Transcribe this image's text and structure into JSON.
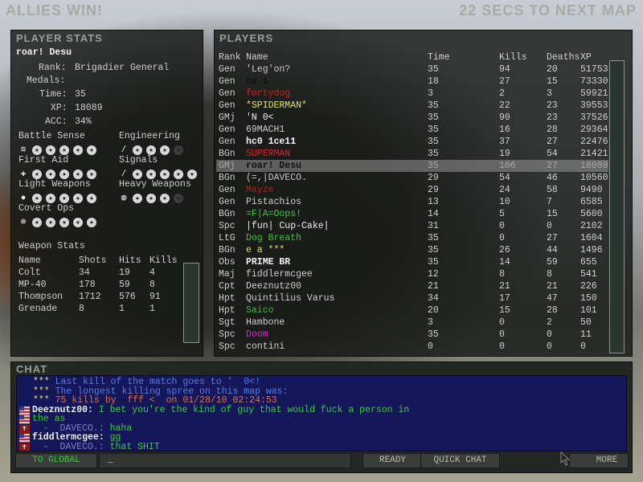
{
  "header": {
    "result": "ALLIES WIN!",
    "countdown": "22 SECS TO NEXT MAP"
  },
  "player_stats": {
    "title": "PLAYER STATS",
    "player_name": "roar! Desu",
    "rank_label": "Rank:",
    "rank": "Brigadier General",
    "medals_label": "Medals:",
    "time_label": "Time:",
    "time": "35",
    "xp_label": "XP:",
    "xp": "18089",
    "acc_label": "ACC:",
    "acc": "34%",
    "skills": [
      {
        "name": "Battle Sense",
        "icon": "radio-signal-icon",
        "level": 5,
        "max": 5
      },
      {
        "name": "Engineering",
        "icon": "wrench-icon",
        "level": 3,
        "max": 4
      },
      {
        "name": "First Aid",
        "icon": "medic-cross-icon",
        "level": 5,
        "max": 5
      },
      {
        "name": "Signals",
        "icon": "flare-icon",
        "level": 5,
        "max": 5
      },
      {
        "name": "Light Weapons",
        "icon": "pistol-icon",
        "level": 5,
        "max": 5
      },
      {
        "name": "Heavy Weapons",
        "icon": "heavy-weapon-icon",
        "level": 3,
        "max": 4
      },
      {
        "name": "Covert Ops",
        "icon": "crosshair-icon",
        "level": 5,
        "max": 5
      }
    ],
    "weapon_stats": {
      "title": "Weapon Stats",
      "columns": [
        "Name",
        "Shots",
        "Hits",
        "Kills"
      ],
      "rows": [
        [
          "Colt",
          "34",
          "19",
          "4"
        ],
        [
          "MP-40",
          "178",
          "59",
          "8"
        ],
        [
          "Thompson",
          "1712",
          "576",
          "91"
        ],
        [
          "Grenade",
          "8",
          "1",
          "1"
        ]
      ]
    }
  },
  "players": {
    "title": "PLAYERS",
    "columns": [
      "Rank",
      "Name",
      "Time",
      "Kills",
      "Deaths",
      "XP"
    ],
    "rows": [
      {
        "rank": "Gen",
        "name": "'Leg'on?",
        "color": "#c8c8c8",
        "time": "35",
        "kills": "94",
        "deaths": "20",
        "xp": "51753"
      },
      {
        "rank": "Gen",
        "name": "ca 1",
        "color": "#111111",
        "time": "18",
        "kills": "27",
        "deaths": "15",
        "xp": "73330"
      },
      {
        "rank": "Gen",
        "name": "fortydog",
        "color": "#d02020",
        "time": "3",
        "kills": "2",
        "deaths": "3",
        "xp": "59921"
      },
      {
        "rank": "Gen",
        "name": "*SPIDERMAN*",
        "color": "#e6e060",
        "time": "35",
        "kills": "22",
        "deaths": "23",
        "xp": "39553"
      },
      {
        "rank": "GMj",
        "name": "'N 0<",
        "color": "#f0f0f0",
        "time": "35",
        "kills": "90",
        "deaths": "23",
        "xp": "37526"
      },
      {
        "rank": "Gen",
        "name": "69MACH1",
        "color": "#cfcfcf",
        "time": "35",
        "kills": "16",
        "deaths": "28",
        "xp": "29364"
      },
      {
        "rank": "Gen",
        "name": "hc0 1ce11",
        "color": "#f4f4f4",
        "time": "35",
        "kills": "37",
        "deaths": "27",
        "xp": "22476"
      },
      {
        "rank": "BGn",
        "name": "SUPERMAN",
        "color": "#e02020",
        "time": "35",
        "kills": "19",
        "deaths": "54",
        "xp": "21421"
      },
      {
        "rank": "GMj",
        "name": "roar! Desu",
        "color": "#111111",
        "time": "35",
        "kills": "106",
        "deaths": "27",
        "xp": "18089",
        "highlight": true
      },
      {
        "rank": "BGn",
        "name": "(=,|DAVECO.",
        "color": "#c8c8c8",
        "time": "29",
        "kills": "54",
        "deaths": "46",
        "xp": "10560"
      },
      {
        "rank": "Gen",
        "name": "Mayze",
        "color": "#b02020",
        "time": "29",
        "kills": "24",
        "deaths": "58",
        "xp": "9490"
      },
      {
        "rank": "Gen",
        "name": "Pistachios",
        "color": "#cfcfcf",
        "time": "13",
        "kills": "10",
        "deaths": "7",
        "xp": "6585"
      },
      {
        "rank": "BGn",
        "name": "=F|A=Oops!",
        "color": "#30d030",
        "time": "14",
        "kills": "5",
        "deaths": "15",
        "xp": "5600"
      },
      {
        "rank": "Spc",
        "name": "|fun| Cup-Cake|",
        "color": "#f0f0f0",
        "time": "31",
        "kills": "0",
        "deaths": "0",
        "xp": "2102"
      },
      {
        "rank": "LtG",
        "name": "Dog Breath",
        "color": "#30d030",
        "time": "35",
        "kills": "0",
        "deaths": "27",
        "xp": "1604"
      },
      {
        "rank": "BGn",
        "name": "e a ***",
        "color": "#e6e060",
        "time": "35",
        "kills": "26",
        "deaths": "44",
        "xp": "1496"
      },
      {
        "rank": "Obs",
        "name": "PRIME BR",
        "color": "#f4f4f4",
        "time": "35",
        "kills": "14",
        "deaths": "59",
        "xp": "655"
      },
      {
        "rank": "Maj",
        "name": "fiddlermcgee",
        "color": "#cfcfcf",
        "time": "12",
        "kills": "8",
        "deaths": "8",
        "xp": "541"
      },
      {
        "rank": "Cpt",
        "name": "Deeznutz00",
        "color": "#cfcfcf",
        "time": "21",
        "kills": "21",
        "deaths": "21",
        "xp": "226"
      },
      {
        "rank": "Hpt",
        "name": "Quintilius Varus",
        "color": "#cfcfcf",
        "time": "34",
        "kills": "17",
        "deaths": "47",
        "xp": "150"
      },
      {
        "rank": "Hpt",
        "name": "Saico",
        "color": "#30c030",
        "time": "20",
        "kills": "15",
        "deaths": "28",
        "xp": "101"
      },
      {
        "rank": "Sgt",
        "name": "Hambone",
        "color": "#cfcfcf",
        "time": "3",
        "kills": "0",
        "deaths": "2",
        "xp": "50"
      },
      {
        "rank": "Spc",
        "name": "Doom",
        "color": "#d030d0",
        "time": "35",
        "kills": "0",
        "deaths": "0",
        "xp": "11"
      },
      {
        "rank": "Spc",
        "name": "contini",
        "color": "#cfcfcf",
        "time": "0",
        "kills": "0",
        "deaths": "0",
        "xp": "0"
      }
    ]
  },
  "chat": {
    "title": "CHAT",
    "lines": [
      {
        "prefix": "***",
        "text": "Last kill of the match goes to '  0<!",
        "color": "#5a7de0",
        "flag": ""
      },
      {
        "prefix": "***",
        "text": "The longest killing spree on this map was:",
        "color": "#5a7de0",
        "flag": ""
      },
      {
        "prefix": "***",
        "text": "75 kills by  fff <  on 01/28/10 02:24:53",
        "color": "#e07040",
        "flag": ""
      },
      {
        "prefix": "",
        "speaker": "Deeznutz00:",
        "text": "I bet you're the kind of guy that would fuck a person in",
        "color": "#30d030",
        "flag": "us"
      },
      {
        "prefix": "",
        "speaker": "",
        "text": "the as",
        "color": "#30d030",
        "flag": "us"
      },
      {
        "prefix": "",
        "speaker": "  -  DAVECO.:",
        "text": "haha",
        "color": "#30d030",
        "flag": "axis"
      },
      {
        "prefix": "",
        "speaker": "fiddlermcgee:",
        "text": "gg",
        "color": "#30d030",
        "flag": "us"
      },
      {
        "prefix": "",
        "speaker": "  -  DAVECO.:",
        "text": "that SHIT",
        "color": "#30d030",
        "flag": "axis"
      }
    ],
    "to_global_label": "TO GLOBAL",
    "input_value": "_",
    "ready_label": "READY",
    "quick_chat_label": "QUICK CHAT",
    "more_label": "MORE"
  }
}
